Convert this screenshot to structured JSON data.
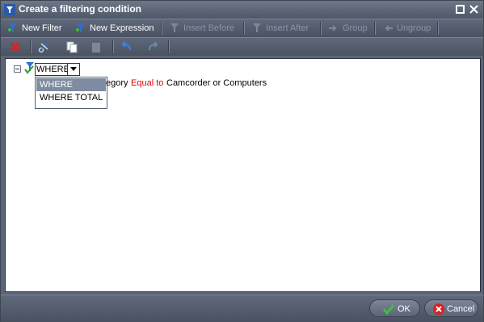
{
  "window": {
    "title": "Create a filtering condition"
  },
  "toolbar1": {
    "new_filter": "New Filter",
    "new_expression": "New Expression",
    "insert_before": "Insert Before",
    "insert_after": "Insert After",
    "group": "Group",
    "ungroup": "Ungroup"
  },
  "tree": {
    "where_value": "WHERE",
    "options": [
      "WHERE",
      "WHERE TOTAL"
    ],
    "selected_index": 0,
    "condition_field_visible": "egory",
    "operator": "Equal to",
    "value": "Camcorder or Computers"
  },
  "footer": {
    "ok": "OK",
    "cancel": "Cancel"
  },
  "colors": {
    "operator": "#e00000",
    "toolbar_bg": "#4a5261",
    "selected_option_bg": "#7f8ba0"
  },
  "icons": {
    "app": "filter-app-icon",
    "new_filter": "new-filter-icon",
    "new_expression": "new-expression-icon",
    "delete": "delete-icon",
    "cut": "cut-icon",
    "copy": "copy-icon",
    "paste": "paste-icon",
    "undo": "undo-icon",
    "redo": "redo-icon",
    "ok": "checkmark-icon",
    "cancel": "cancel-icon"
  }
}
